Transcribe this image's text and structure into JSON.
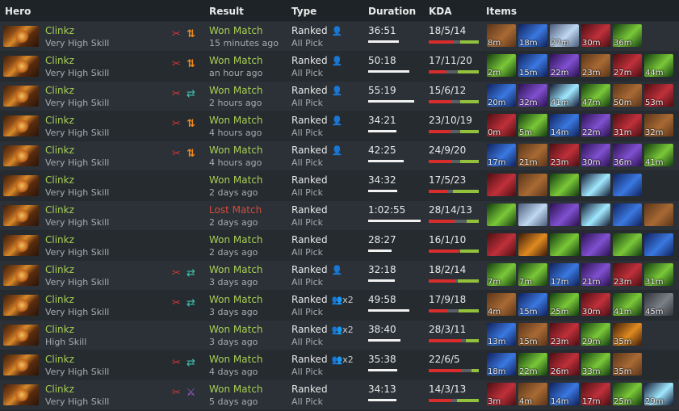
{
  "header": {
    "hero": "Hero",
    "result": "Result",
    "type": "Type",
    "duration": "Duration",
    "kda": "KDA",
    "items": "Items"
  },
  "colors": {
    "won": "#a9cf54",
    "lost": "#d74b3b",
    "kills": "#d92d2d",
    "deaths": "#5a5f64",
    "assists": "#93c13c"
  },
  "item_palette": {
    "boots": [
      "#5a3418",
      "#a86a34"
    ],
    "blue": [
      "#10205a",
      "#3a78e0"
    ],
    "crystal": [
      "#4a5a7a",
      "#c0d8f0"
    ],
    "red": [
      "#4a0e12",
      "#c0303a"
    ],
    "green": [
      "#123a10",
      "#7ac838"
    ],
    "purple": [
      "#2a1050",
      "#8050d0"
    ],
    "orb": [
      "#101830",
      "#a0e8ff"
    ],
    "fire": [
      "#3a1a08",
      "#e08a20"
    ],
    "gray": [
      "#303438",
      "#7a8088"
    ]
  },
  "matches": [
    {
      "hero": "Clinkz",
      "skill": "Very High Skill",
      "icon2": "arrows-updown-icon",
      "icon2_color": "orange",
      "result": "Won Match",
      "outcome": "won",
      "when": "15 minutes ago",
      "type": "Ranked",
      "party": "solo",
      "party_count": "",
      "mode": "All Pick",
      "duration": "36:51",
      "dur_fraction": 0.57,
      "kda": "18/5/14",
      "k": 18,
      "d": 5,
      "a": 14,
      "items": [
        {
          "t": "8m",
          "s": "boots"
        },
        {
          "t": "18m",
          "s": "blue"
        },
        {
          "t": "27m",
          "s": "crystal"
        },
        {
          "t": "30m",
          "s": "red"
        },
        {
          "t": "36m",
          "s": "green"
        }
      ]
    },
    {
      "hero": "Clinkz",
      "skill": "Very High Skill",
      "icon2": "arrows-updown-icon",
      "icon2_color": "orange",
      "result": "Won Match",
      "outcome": "won",
      "when": "an hour ago",
      "type": "Ranked",
      "party": "solo",
      "party_count": "",
      "mode": "All Pick",
      "duration": "50:18",
      "dur_fraction": 0.78,
      "kda": "17/11/20",
      "k": 17,
      "d": 11,
      "a": 20,
      "items": [
        {
          "t": "2m",
          "s": "green"
        },
        {
          "t": "15m",
          "s": "blue"
        },
        {
          "t": "22m",
          "s": "purple"
        },
        {
          "t": "23m",
          "s": "boots"
        },
        {
          "t": "27m",
          "s": "red"
        },
        {
          "t": "44m",
          "s": "green"
        }
      ]
    },
    {
      "hero": "Clinkz",
      "skill": "Very High Skill",
      "icon2": "swap-icon",
      "icon2_color": "teal",
      "result": "Won Match",
      "outcome": "won",
      "when": "2 hours ago",
      "type": "Ranked",
      "party": "solo",
      "party_count": "",
      "mode": "All Pick",
      "duration": "55:19",
      "dur_fraction": 0.86,
      "kda": "15/6/12",
      "k": 15,
      "d": 6,
      "a": 12,
      "items": [
        {
          "t": "20m",
          "s": "blue"
        },
        {
          "t": "32m",
          "s": "purple"
        },
        {
          "t": "41m",
          "s": "orb"
        },
        {
          "t": "47m",
          "s": "green"
        },
        {
          "t": "50m",
          "s": "boots"
        },
        {
          "t": "53m",
          "s": "red"
        }
      ]
    },
    {
      "hero": "Clinkz",
      "skill": "Very High Skill",
      "icon2": "arrows-updown-icon",
      "icon2_color": "orange",
      "result": "Won Match",
      "outcome": "won",
      "when": "4 hours ago",
      "type": "Ranked",
      "party": "solo",
      "party_count": "",
      "mode": "All Pick",
      "duration": "34:21",
      "dur_fraction": 0.53,
      "kda": "23/10/19",
      "k": 23,
      "d": 10,
      "a": 19,
      "items": [
        {
          "t": "0m",
          "s": "red"
        },
        {
          "t": "5m",
          "s": "green"
        },
        {
          "t": "14m",
          "s": "blue"
        },
        {
          "t": "22m",
          "s": "purple"
        },
        {
          "t": "31m",
          "s": "red"
        },
        {
          "t": "32m",
          "s": "boots"
        }
      ]
    },
    {
      "hero": "Clinkz",
      "skill": "Very High Skill",
      "icon2": "arrows-updown-icon",
      "icon2_color": "orange",
      "result": "Won Match",
      "outcome": "won",
      "when": "4 hours ago",
      "type": "Ranked",
      "party": "solo",
      "party_count": "",
      "mode": "All Pick",
      "duration": "42:25",
      "dur_fraction": 0.66,
      "kda": "24/9/20",
      "k": 24,
      "d": 9,
      "a": 20,
      "items": [
        {
          "t": "17m",
          "s": "blue"
        },
        {
          "t": "21m",
          "s": "boots"
        },
        {
          "t": "23m",
          "s": "red"
        },
        {
          "t": "30m",
          "s": "purple"
        },
        {
          "t": "36m",
          "s": "purple"
        },
        {
          "t": "41m",
          "s": "green"
        }
      ]
    },
    {
      "hero": "Clinkz",
      "skill": "Very High Skill",
      "icon2": "",
      "icon2_color": "",
      "result": "Won Match",
      "outcome": "won",
      "when": "2 days ago",
      "type": "Ranked",
      "party": "",
      "party_count": "",
      "mode": "All Pick",
      "duration": "34:32",
      "dur_fraction": 0.54,
      "kda": "17/5/23",
      "k": 17,
      "d": 5,
      "a": 23,
      "items": [
        {
          "t": "",
          "s": "red"
        },
        {
          "t": "",
          "s": "boots"
        },
        {
          "t": "",
          "s": "green"
        },
        {
          "t": "",
          "s": "orb"
        },
        {
          "t": "",
          "s": "blue"
        }
      ]
    },
    {
      "hero": "Clinkz",
      "skill": "Very High Skill",
      "icon2": "",
      "icon2_color": "",
      "result": "Lost Match",
      "outcome": "lost",
      "when": "2 days ago",
      "type": "Ranked",
      "party": "",
      "party_count": "",
      "mode": "All Pick",
      "duration": "1:02:55",
      "dur_fraction": 0.98,
      "kda": "28/14/13",
      "k": 28,
      "d": 14,
      "a": 13,
      "items": [
        {
          "t": "",
          "s": "green"
        },
        {
          "t": "",
          "s": "crystal"
        },
        {
          "t": "",
          "s": "purple"
        },
        {
          "t": "",
          "s": "orb"
        },
        {
          "t": "",
          "s": "blue"
        },
        {
          "t": "",
          "s": "boots"
        }
      ]
    },
    {
      "hero": "Clinkz",
      "skill": "Very High Skill",
      "icon2": "",
      "icon2_color": "",
      "result": "Won Match",
      "outcome": "won",
      "when": "2 days ago",
      "type": "Ranked",
      "party": "",
      "party_count": "",
      "mode": "All Pick",
      "duration": "28:27",
      "dur_fraction": 0.44,
      "kda": "16/1/10",
      "k": 16,
      "d": 1,
      "a": 10,
      "items": [
        {
          "t": "",
          "s": "red"
        },
        {
          "t": "",
          "s": "fire"
        },
        {
          "t": "",
          "s": "green"
        },
        {
          "t": "",
          "s": "purple"
        },
        {
          "t": "",
          "s": "green"
        },
        {
          "t": "",
          "s": "blue"
        }
      ]
    },
    {
      "hero": "Clinkz",
      "skill": "Very High Skill",
      "icon2": "swap-icon",
      "icon2_color": "teal",
      "result": "Won Match",
      "outcome": "won",
      "when": "3 days ago",
      "type": "Ranked",
      "party": "solo",
      "party_count": "",
      "mode": "All Pick",
      "duration": "32:18",
      "dur_fraction": 0.5,
      "kda": "18/2/14",
      "k": 18,
      "d": 2,
      "a": 14,
      "items": [
        {
          "t": "7m",
          "s": "green"
        },
        {
          "t": "7m",
          "s": "green"
        },
        {
          "t": "17m",
          "s": "blue"
        },
        {
          "t": "21m",
          "s": "purple"
        },
        {
          "t": "23m",
          "s": "red"
        },
        {
          "t": "31m",
          "s": "green"
        }
      ]
    },
    {
      "hero": "Clinkz",
      "skill": "Very High Skill",
      "icon2": "swap-icon",
      "icon2_color": "teal",
      "result": "Won Match",
      "outcome": "won",
      "when": "3 days ago",
      "type": "Ranked",
      "party": "group",
      "party_count": "x2",
      "mode": "All Pick",
      "duration": "49:58",
      "dur_fraction": 0.77,
      "kda": "17/9/18",
      "k": 17,
      "d": 9,
      "a": 18,
      "items": [
        {
          "t": "4m",
          "s": "boots"
        },
        {
          "t": "15m",
          "s": "blue"
        },
        {
          "t": "25m",
          "s": "green"
        },
        {
          "t": "30m",
          "s": "red"
        },
        {
          "t": "41m",
          "s": "green"
        },
        {
          "t": "45m",
          "s": "gray"
        }
      ]
    },
    {
      "hero": "Clinkz",
      "skill": "High Skill",
      "icon2": "",
      "icon2_color": "",
      "result": "Won Match",
      "outcome": "won",
      "when": "3 days ago",
      "type": "Ranked",
      "party": "group",
      "party_count": "x2",
      "mode": "All Pick",
      "duration": "38:40",
      "dur_fraction": 0.6,
      "kda": "28/3/11",
      "k": 28,
      "d": 3,
      "a": 11,
      "items": [
        {
          "t": "13m",
          "s": "blue"
        },
        {
          "t": "15m",
          "s": "boots"
        },
        {
          "t": "23m",
          "s": "red"
        },
        {
          "t": "29m",
          "s": "green"
        },
        {
          "t": "35m",
          "s": "fire"
        }
      ]
    },
    {
      "hero": "Clinkz",
      "skill": "Very High Skill",
      "icon2": "swap-icon",
      "icon2_color": "teal",
      "result": "Won Match",
      "outcome": "won",
      "when": "4 days ago",
      "type": "Ranked",
      "party": "group",
      "party_count": "x2",
      "mode": "All Pick",
      "duration": "35:38",
      "dur_fraction": 0.55,
      "kda": "22/6/5",
      "k": 22,
      "d": 6,
      "a": 5,
      "items": [
        {
          "t": "18m",
          "s": "blue"
        },
        {
          "t": "22m",
          "s": "green"
        },
        {
          "t": "26m",
          "s": "red"
        },
        {
          "t": "33m",
          "s": "green"
        },
        {
          "t": "35m",
          "s": "boots"
        }
      ]
    },
    {
      "hero": "Clinkz",
      "skill": "Very High Skill",
      "icon2": "sword-icon",
      "icon2_color": "purple",
      "result": "Won Match",
      "outcome": "won",
      "when": "5 days ago",
      "type": "Ranked",
      "party": "",
      "party_count": "",
      "mode": "All Pick",
      "duration": "34:13",
      "dur_fraction": 0.53,
      "kda": "14/3/13",
      "k": 14,
      "d": 3,
      "a": 13,
      "items": [
        {
          "t": "3m",
          "s": "red"
        },
        {
          "t": "4m",
          "s": "boots"
        },
        {
          "t": "14m",
          "s": "blue"
        },
        {
          "t": "17m",
          "s": "red"
        },
        {
          "t": "25m",
          "s": "green"
        },
        {
          "t": "29m",
          "s": "orb"
        }
      ]
    }
  ]
}
